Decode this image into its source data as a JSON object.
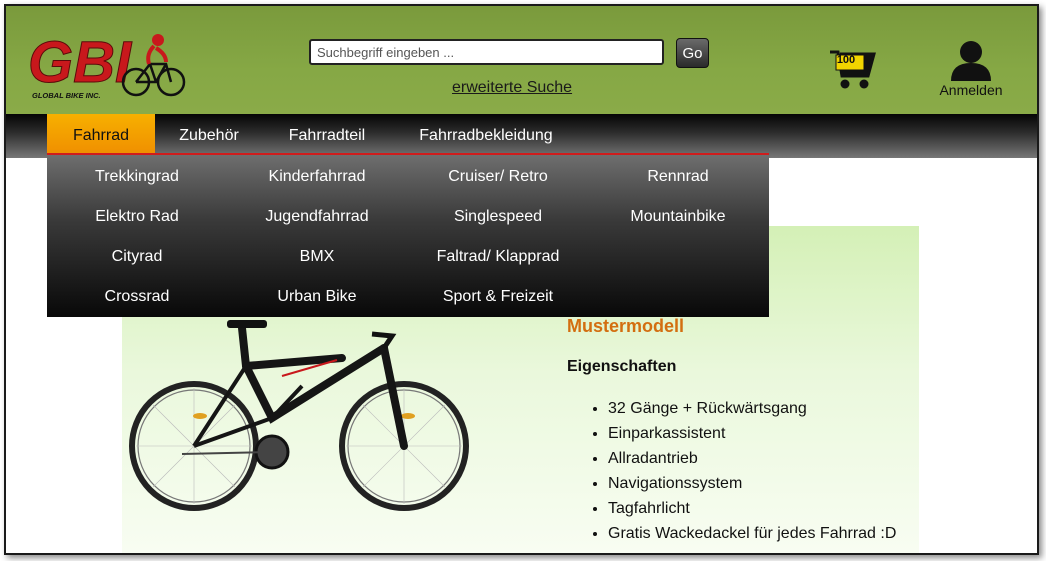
{
  "header": {
    "logo": {
      "mark": "GBI",
      "tagline": "GLOBAL BIKE INC."
    },
    "search": {
      "placeholder": "Suchbegriff eingeben ...",
      "value": ""
    },
    "go_label": "Go",
    "advanced_search_label": "erweiterte Suche",
    "cart": {
      "count": "100",
      "icon": "cart-icon"
    },
    "login": {
      "label": "Anmelden",
      "icon": "user-icon"
    }
  },
  "nav": {
    "items": [
      {
        "label": "Fahrrad",
        "active": true
      },
      {
        "label": "Zubehör",
        "active": false
      },
      {
        "label": "Fahrradteil",
        "active": false
      },
      {
        "label": "Fahrradbekleidung",
        "active": false
      }
    ]
  },
  "dropdown": {
    "rows": [
      [
        "Trekkingrad",
        "Kinderfahrrad",
        "Cruiser/ Retro",
        "Rennrad"
      ],
      [
        "Elektro Rad",
        "Jugendfahrrad",
        "Singlespeed",
        "Mountainbike"
      ],
      [
        "Cityrad",
        "BMX",
        "Faltrad/ Klapprad",
        ""
      ],
      [
        "Crossrad",
        "Urban Bike",
        "Sport & Freizeit",
        ""
      ]
    ]
  },
  "product": {
    "title": "Mustermodell",
    "features_heading": "Eigenschaften",
    "features": [
      "32 Gänge + Rückwärtsgang",
      "Einparkassistent",
      "Allradantrieb",
      "Navigationssystem",
      "Tagfahrlicht",
      "Gratis Wackedackel für jedes Fahrrad :D"
    ]
  },
  "colors": {
    "header_green": "#86a845",
    "nav_active": "#ef8c00",
    "accent_red": "#d01c1c",
    "product_title": "#d36e10"
  }
}
